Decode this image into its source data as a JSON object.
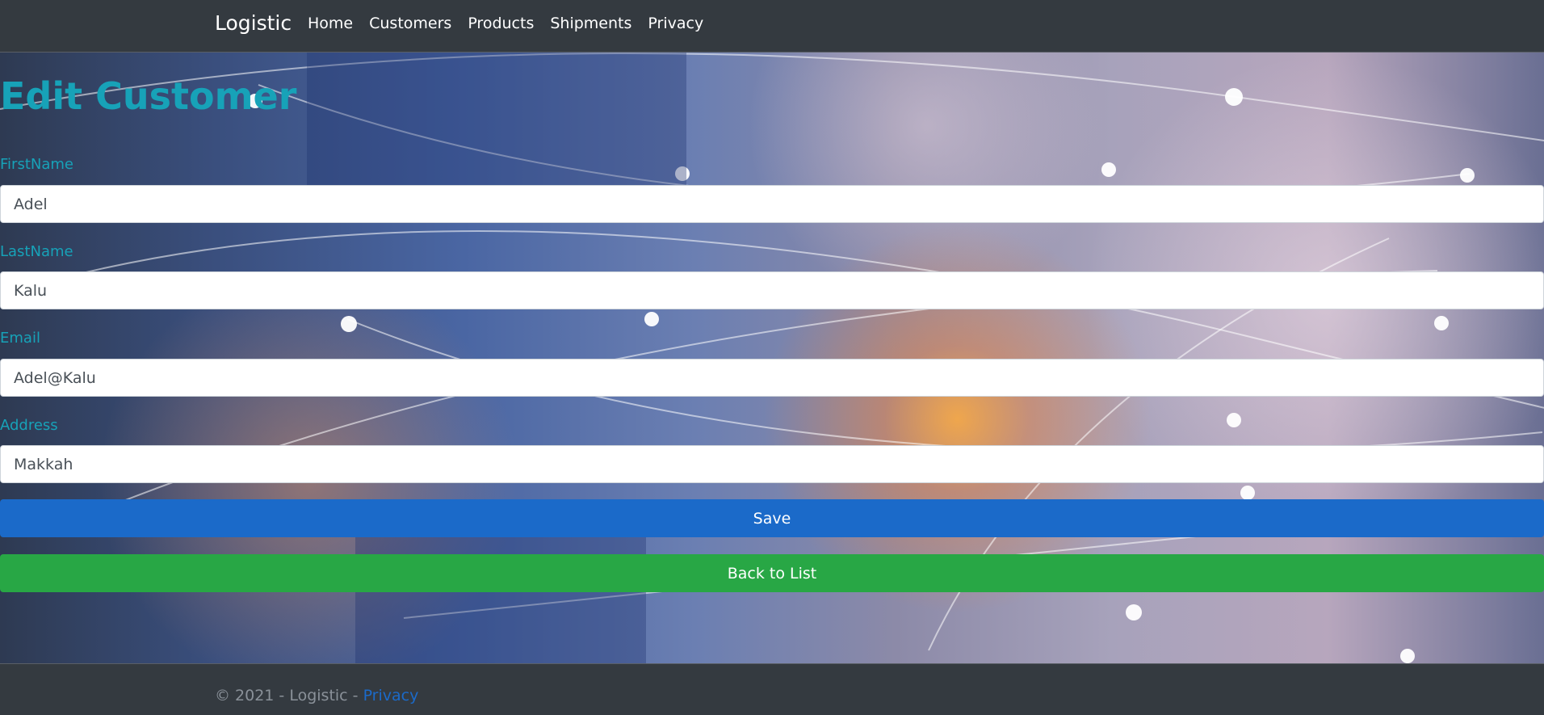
{
  "nav": {
    "brand": "Logistic",
    "links": [
      "Home",
      "Customers",
      "Products",
      "Shipments",
      "Privacy"
    ]
  },
  "page": {
    "title": "Edit Customer"
  },
  "form": {
    "fields": [
      {
        "label": "FirstName",
        "value": "Adel"
      },
      {
        "label": "LastName",
        "value": "Kalu"
      },
      {
        "label": "Email",
        "value": "Adel@Kalu"
      },
      {
        "label": "Address",
        "value": "Makkah"
      }
    ],
    "save_label": "Save",
    "back_label": "Back to List"
  },
  "footer": {
    "text": "© 2021 - Logistic - ",
    "link": "Privacy"
  },
  "colors": {
    "accent": "#17a2b8",
    "primary": "#1b6ac9",
    "success": "#28a745",
    "nav_bg": "#343a40"
  }
}
